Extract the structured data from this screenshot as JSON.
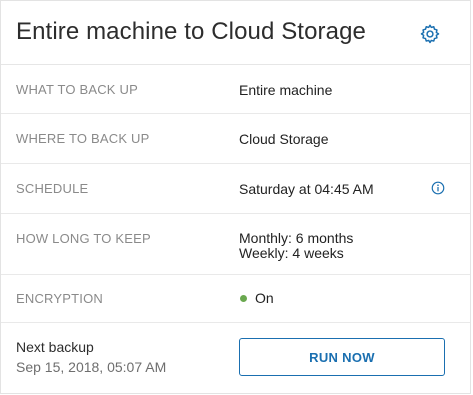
{
  "plan": {
    "title": "Entire machine to Cloud Storage"
  },
  "details": [
    {
      "label": "WHAT TO BACK UP",
      "value": "Entire machine"
    },
    {
      "label": "WHERE TO BACK UP",
      "value": "Cloud Storage"
    },
    {
      "label": "SCHEDULE",
      "value": "Saturday at 04:45 AM"
    },
    {
      "label": "HOW LONG TO KEEP",
      "value_line1": "Monthly: 6 months",
      "value_line2": "Weekly: 4 weeks"
    },
    {
      "label": "ENCRYPTION",
      "value": "On"
    }
  ],
  "footer": {
    "next_backup_label": "Next backup",
    "next_backup_time": "Sep 15, 2018, 05:07 AM",
    "run_now_label": "RUN NOW"
  },
  "icons": {
    "settings": "gear-icon",
    "schedule_info": "info-icon",
    "encryption_status": "status-dot"
  },
  "colors": {
    "accent": "#1a6fb0",
    "status_on": "#6aa84f",
    "label_gray": "#8a8a8a"
  }
}
